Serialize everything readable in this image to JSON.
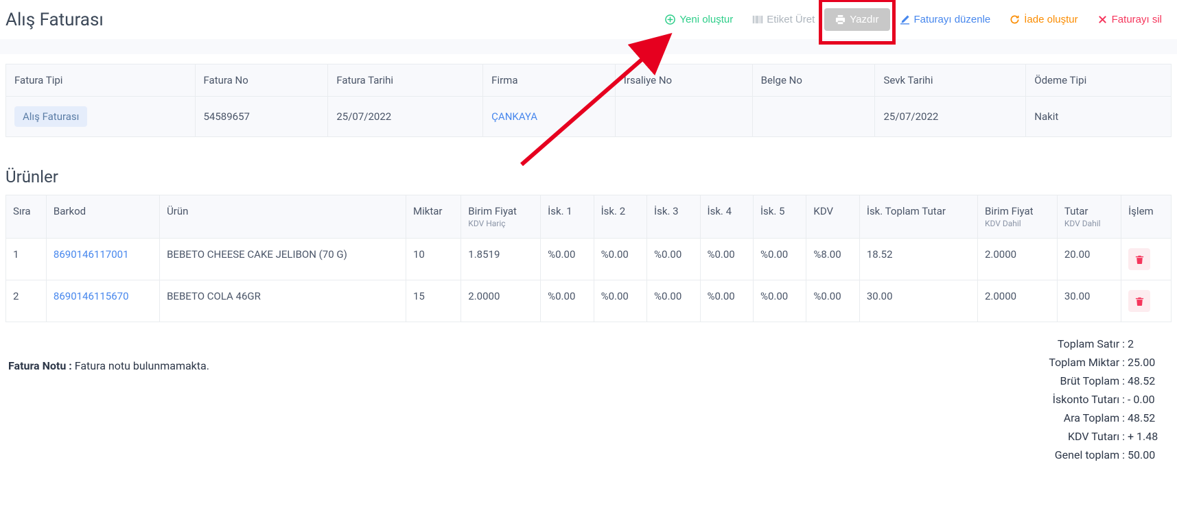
{
  "header": {
    "title": "Alış Faturası",
    "buttons": {
      "new": "Yeni oluştur",
      "label": "Etiket Üret",
      "print": "Yazdır",
      "edit": "Faturayı düzenle",
      "return": "İade oluştur",
      "delete": "Faturayı sil"
    }
  },
  "info": {
    "headers": {
      "type": "Fatura Tipi",
      "no": "Fatura No",
      "date": "Fatura Tarihi",
      "firm": "Firma",
      "waybill": "İrsaliye No",
      "doc": "Belge No",
      "ship": "Sevk Tarihi",
      "payment": "Ödeme Tipi"
    },
    "values": {
      "type": "Alış Faturası",
      "no": "54589657",
      "date": "25/07/2022",
      "firm": "ÇANKAYA",
      "waybill": "",
      "doc": "",
      "ship": "25/07/2022",
      "payment": "Nakit"
    }
  },
  "products": {
    "title": "Ürünler",
    "headers": {
      "sira": "Sıra",
      "barkod": "Barkod",
      "urun": "Ürün",
      "miktar": "Miktar",
      "birim_fiyat": "Birim Fiyat",
      "birim_fiyat_sub": "KDV Hariç",
      "isk1": "İsk. 1",
      "isk2": "İsk. 2",
      "isk3": "İsk. 3",
      "isk4": "İsk. 4",
      "isk5": "İsk. 5",
      "kdv": "KDV",
      "isk_toplam": "İsk. Toplam Tutar",
      "birim_dahil": "Birim Fiyat",
      "birim_dahil_sub": "KDV Dahil",
      "tutar": "Tutar",
      "tutar_sub": "KDV Dahil",
      "islem": "İşlem"
    },
    "rows": [
      {
        "sira": "1",
        "barkod": "8690146117001",
        "urun": "BEBETO CHEESE CAKE JELIBON (70 G)",
        "miktar": "10",
        "birim_fiyat": "1.8519",
        "isk1": "%0.00",
        "isk2": "%0.00",
        "isk3": "%0.00",
        "isk4": "%0.00",
        "isk5": "%0.00",
        "kdv": "%8.00",
        "isk_toplam": "18.52",
        "birim_dahil": "2.0000",
        "tutar": "20.00"
      },
      {
        "sira": "2",
        "barkod": "8690146115670",
        "urun": "BEBETO COLA 46GR",
        "miktar": "15",
        "birim_fiyat": "2.0000",
        "isk1": "%0.00",
        "isk2": "%0.00",
        "isk3": "%0.00",
        "isk4": "%0.00",
        "isk5": "%0.00",
        "kdv": "%0.00",
        "isk_toplam": "30.00",
        "birim_dahil": "2.0000",
        "tutar": "30.00"
      }
    ]
  },
  "note": {
    "label": "Fatura Notu : ",
    "text": "Fatura notu bulunmamakta."
  },
  "totals": {
    "rows": [
      {
        "label": "Toplam Satır :",
        "value": "2"
      },
      {
        "label": "Toplam Miktar :",
        "value": "25.00"
      },
      {
        "label": "Brüt Toplam :",
        "value": "48.52"
      },
      {
        "label": "İskonto Tutarı :",
        "value": "- 0.00"
      },
      {
        "label": "Ara Toplam :",
        "value": "48.52"
      },
      {
        "label": "KDV Tutarı :",
        "value": "+ 1.48"
      },
      {
        "label": "Genel toplam :",
        "value": "50.00"
      }
    ]
  }
}
